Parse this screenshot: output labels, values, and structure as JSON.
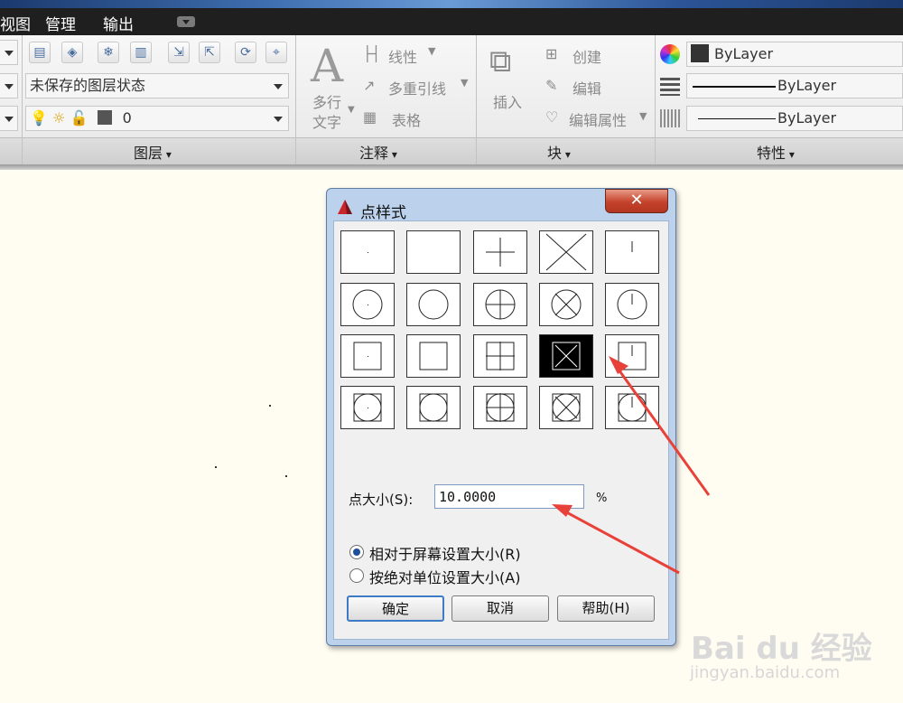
{
  "menu": {
    "item1": "视图",
    "item2": "管理",
    "item3": "输出"
  },
  "ribbon": {
    "layers": {
      "title": "图层",
      "state_combo": "未保存的图层状态",
      "layer_combo": "0"
    },
    "annotation": {
      "title": "注释",
      "multiline_text_1": "多行",
      "multiline_text_2": "文字",
      "linear": "线性",
      "multileader": "多重引线",
      "table": "表格"
    },
    "block": {
      "title": "块",
      "insert": "插入",
      "create": "创建",
      "edit": "编辑",
      "edit_attributes": "编辑属性"
    },
    "properties": {
      "title": "特性",
      "color": "ByLayer",
      "linetype": "ByLayer",
      "lineweight": "ByLayer"
    }
  },
  "dialog": {
    "title": "点样式",
    "close_glyph": "✕",
    "size_label": "点大小(S):",
    "size_value": "10.0000",
    "percent": "%",
    "radio_relative": "相对于屏幕设置大小(R)",
    "radio_absolute": "按绝对单位设置大小(A)",
    "ok": "确定",
    "cancel": "取消",
    "help": "帮助(H)",
    "selected_style_index": 13,
    "selected_radio": "relative"
  },
  "watermark": {
    "logo": "Bai du 经验",
    "url": "jingyan.baidu.com"
  },
  "colors": {
    "annotation_arrow": "#e8413a",
    "close_button": "#c5422a",
    "menubar": "#1f1f1f",
    "canvas": "#fffdf2"
  }
}
